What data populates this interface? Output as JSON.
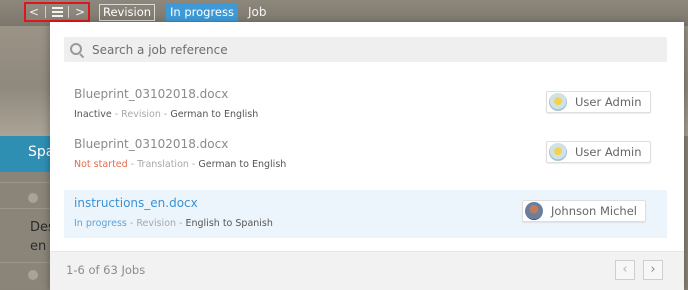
{
  "breadcrumb": {
    "prev_glyph": "<",
    "next_glyph": ">",
    "badge_revision": "Revision",
    "badge_status": "In progress",
    "current": "Job"
  },
  "background": {
    "tab_label": "Spa",
    "row_text_1": "Des",
    "row_text_2": "en"
  },
  "search": {
    "placeholder": "Search a job reference"
  },
  "jobs": [
    {
      "title": "Blueprint_03102018.docx",
      "status": "Inactive",
      "task": "Revision",
      "languages": "German to English",
      "assignee": "User Admin",
      "avatar": "user-admin-avatar"
    },
    {
      "title": "Blueprint_03102018.docx",
      "status": "Not started",
      "task": "Translation",
      "languages": "German to English",
      "assignee": "User Admin",
      "avatar": "user-admin-avatar"
    },
    {
      "title": "instructions_en.docx",
      "status": "In progress",
      "task": "Revision",
      "languages": "English to Spanish",
      "assignee": "Johnson Michel",
      "avatar": "johnson-michel-avatar"
    }
  ],
  "separator": " - ",
  "footer": {
    "count": "1-6 of 63 Jobs",
    "prev_glyph": "‹",
    "next_glyph": "›"
  },
  "colors": {
    "status_inactive": "#555555",
    "status_not_started": "#e36b4d",
    "status_in_progress": "#5aa3da",
    "selected_row": "#edf5fc",
    "highlight_box": "#e0141d"
  }
}
